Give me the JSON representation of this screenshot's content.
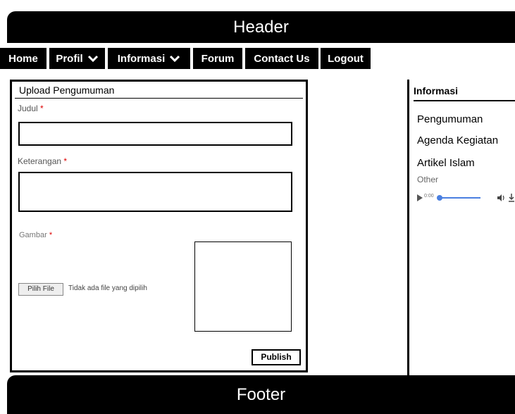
{
  "header": {
    "title": "Header"
  },
  "nav": {
    "items": [
      {
        "label": "Home",
        "dropdown": false
      },
      {
        "label": "Profil",
        "dropdown": true
      },
      {
        "label": "Informasi",
        "dropdown": true
      },
      {
        "label": "Forum",
        "dropdown": false
      },
      {
        "label": "Contact Us",
        "dropdown": false
      },
      {
        "label": "Logout",
        "dropdown": false
      }
    ]
  },
  "form": {
    "title": "Upload Pengumuman",
    "judul_label": "Judul",
    "keterangan_label": "Keterangan",
    "gambar_label": "Gambar",
    "required_mark": "*",
    "file_button": "Pilih File",
    "file_status": "Tidak ada file yang dipilih",
    "publish_label": "Publish"
  },
  "sidebar": {
    "title": "Informasi",
    "links": [
      "Pengumuman",
      "Agenda Kegiatan",
      "Artikel Islam"
    ],
    "other_label": "Other",
    "audio_time": "0:00"
  },
  "footer": {
    "title": "Footer"
  },
  "colors": {
    "bar": "#000000",
    "required": "#dd0000",
    "player_accent": "#4a7fe0"
  }
}
